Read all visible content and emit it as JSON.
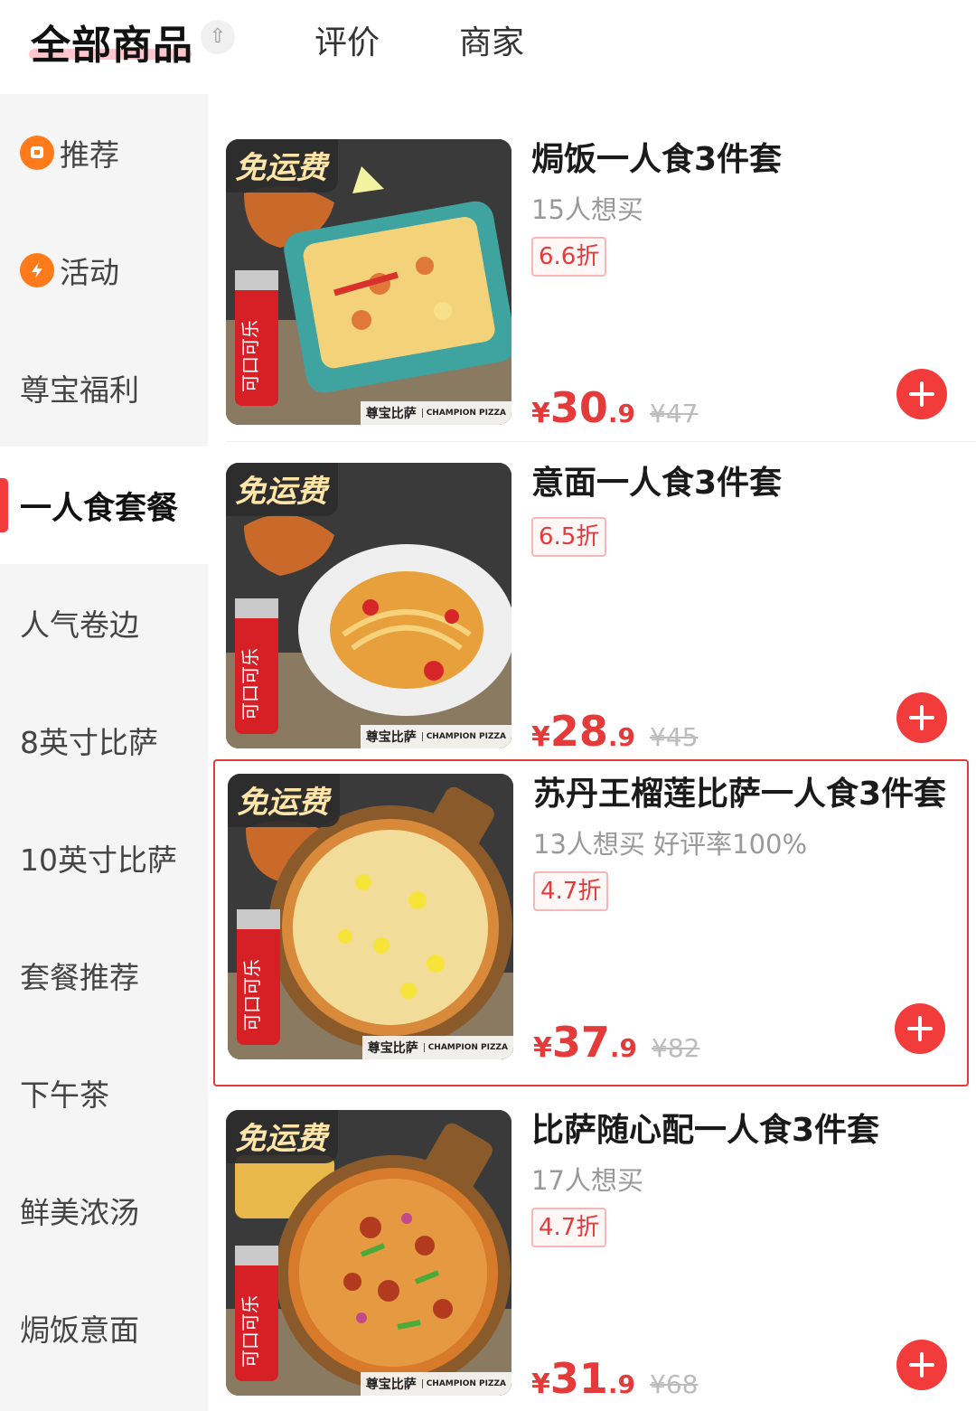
{
  "header": {
    "tabs": [
      {
        "label": "全部商品",
        "active": true
      },
      {
        "label": "评价",
        "active": false
      },
      {
        "label": "商家",
        "active": false
      }
    ],
    "collapse_icon": "collapse-up-icon"
  },
  "sidebar": {
    "items": [
      {
        "label": "推荐",
        "icon": "recommend-badge-icon"
      },
      {
        "label": "活动",
        "icon": "flash-badge-icon"
      },
      {
        "label": "尊宝福利"
      },
      {
        "label": "一人食套餐",
        "active": true
      },
      {
        "label": "人气卷边"
      },
      {
        "label": "8英寸比萨"
      },
      {
        "label": "10英寸比萨"
      },
      {
        "label": "套餐推荐"
      },
      {
        "label": "下午茶"
      },
      {
        "label": "鲜美浓汤"
      },
      {
        "label": "焗饭意面"
      }
    ]
  },
  "products": [
    {
      "title": "焗饭一人食3件套",
      "sub": "15人想买",
      "discount": "6.6折",
      "price_symbol": "¥",
      "price_int": "30",
      "price_dec": ".9",
      "original_price": "¥47",
      "badge": "免运费",
      "brand": "尊宝比萨",
      "brand_en": "CHAMPION PIZZA",
      "highlighted": false
    },
    {
      "title": "意面一人食3件套",
      "sub": "",
      "discount": "6.5折",
      "price_symbol": "¥",
      "price_int": "28",
      "price_dec": ".9",
      "original_price": "¥45",
      "badge": "免运费",
      "brand": "尊宝比萨",
      "brand_en": "CHAMPION PIZZA",
      "highlighted": false
    },
    {
      "title": "苏丹王榴莲比萨一人食3件套",
      "sub": "13人想买 好评率100%",
      "discount": "4.7折",
      "price_symbol": "¥",
      "price_int": "37",
      "price_dec": ".9",
      "original_price": "¥82",
      "badge": "免运费",
      "brand": "尊宝比萨",
      "brand_en": "CHAMPION PIZZA",
      "highlighted": true
    },
    {
      "title": "比萨随心配一人食3件套",
      "sub": "17人想买",
      "discount": "4.7折",
      "price_symbol": "¥",
      "price_int": "31",
      "price_dec": ".9",
      "original_price": "¥68",
      "badge": "免运费",
      "brand": "尊宝比萨",
      "brand_en": "CHAMPION PIZZA",
      "highlighted": false
    }
  ],
  "colors": {
    "accent": "#f23b3b",
    "price": "#e53a3a",
    "sidebar_bg": "#f5f5f5",
    "badge_orange": "#ff7a1a"
  }
}
